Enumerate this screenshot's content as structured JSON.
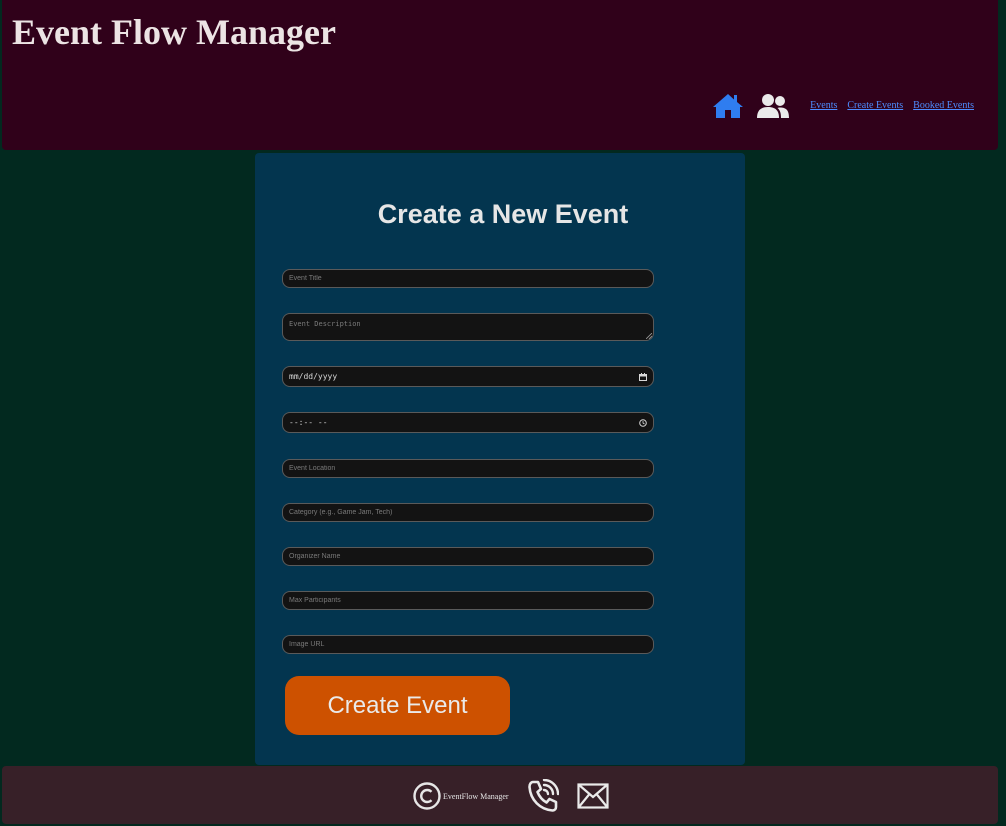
{
  "header": {
    "title": "Event Flow Manager",
    "nav": {
      "home_icon": "home-icon",
      "users_icon": "users-icon",
      "links": [
        "Events",
        "Create Events",
        "Booked Events"
      ]
    }
  },
  "form": {
    "title": "Create a New Event",
    "fields": {
      "title_placeholder": "Event Title",
      "description_placeholder": "Event Description",
      "date_value": "mm/dd/yyyy",
      "time_value": "--:-- --",
      "location_placeholder": "Event Location",
      "category_placeholder": "Category (e.g., Game Jam, Tech)",
      "organizer_placeholder": "Organizer Name",
      "max_participants_placeholder": "Max Participants",
      "image_url_placeholder": "Image URL"
    },
    "submit_label": "Create Event"
  },
  "footer": {
    "copyright_text": "EventFlow Manager",
    "icons": [
      "copyright-icon",
      "phone-icon",
      "mail-icon"
    ]
  },
  "colors": {
    "page_bg": "#02291f",
    "header_bg": "#30011a",
    "card_bg": "#03354f",
    "button_bg": "#cd5100",
    "link": "#4d8cff",
    "home_icon": "#2f7df0",
    "footer_bg": "#372028"
  }
}
